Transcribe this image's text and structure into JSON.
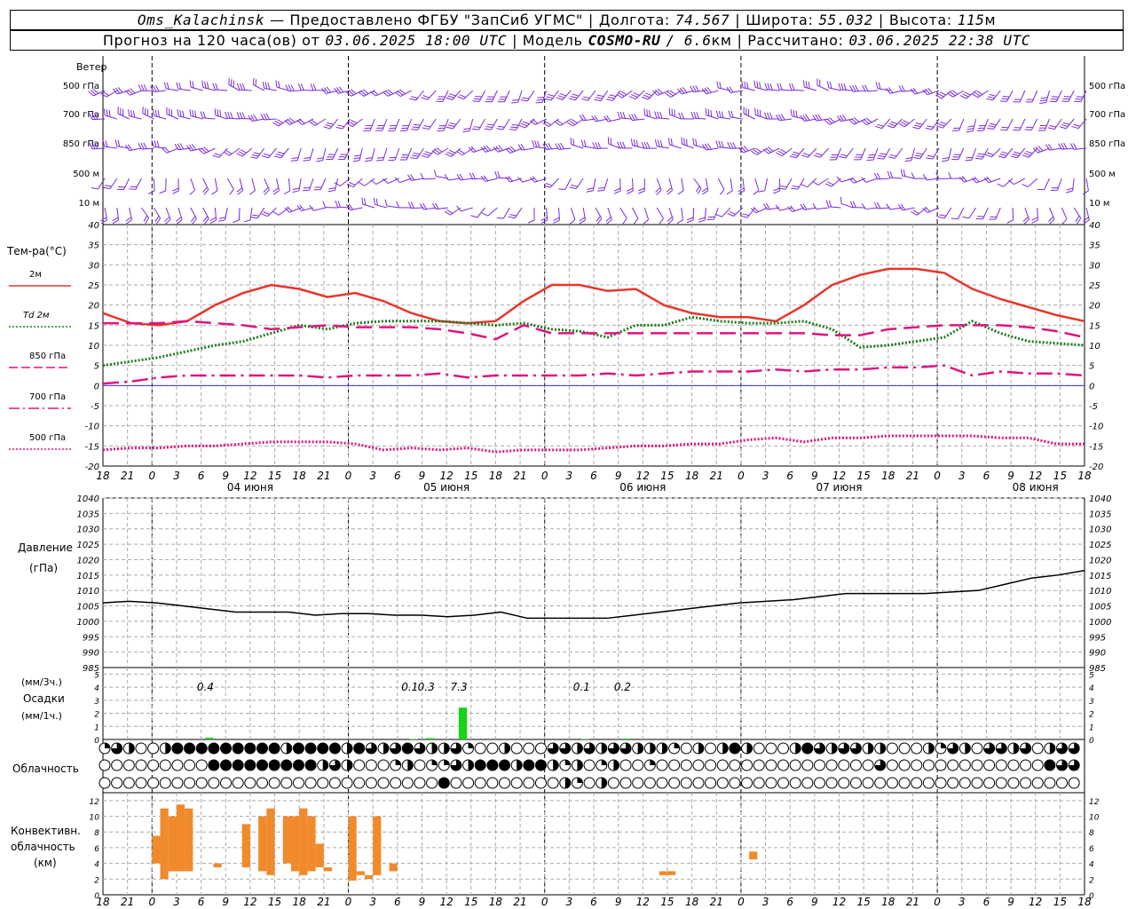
{
  "header": {
    "line1": {
      "station": "Oms_Kalachinsk",
      "provider": "— Предоставлено ФГБУ \"ЗапСиб УГМС\"",
      "lon_label": "Долгота:",
      "lon": "74.567",
      "lat_label": "Широта:",
      "lat": "55.032",
      "alt_label": "Высота:",
      "alt": "115",
      "alt_unit": "м"
    },
    "line2": {
      "forecast_prefix": "Прогноз на 120 часа(ов) от",
      "forecast_time": "03.06.2025 18:00 UTC",
      "model_label": "| Модель",
      "model": "COSMO-RU",
      "model_res": "/ 6.6",
      "model_res_unit": "км",
      "calc_label": "| Рассчитано:",
      "calc_time": "03.06.2025 22:38 UTC"
    }
  },
  "colors": {
    "t2m": "#e8352c",
    "td2m": "#1e7a1e",
    "t850": "#e0147f",
    "t700": "#e0147f",
    "t500": "#e0147f",
    "wind": "#7a2ad6",
    "pressure": "#000000",
    "precip": "#14d414",
    "convective": "#f08a2c",
    "grid": "#aaaaaa",
    "zero_line": "#3030ff"
  },
  "chart_data": [
    {
      "type": "line",
      "name": "wind-panel",
      "title": "Ветер",
      "levels": [
        "500 гПа",
        "700 гПа",
        "850 гПа",
        "500 м",
        "10 м"
      ],
      "icon": "wind-barb",
      "note_icon": "calm-circle"
    },
    {
      "type": "line",
      "name": "temperature-panel",
      "ylabel": "Тем-ра(°C)",
      "ylim": [
        -20,
        40
      ],
      "yticks": [
        -20,
        -15,
        -10,
        -5,
        0,
        5,
        10,
        15,
        20,
        25,
        30,
        35,
        40
      ],
      "x_hours": [
        0,
        3,
        6,
        9,
        12,
        15,
        18,
        21,
        24,
        27,
        30,
        33,
        36,
        39,
        42,
        45,
        48,
        51,
        54,
        57,
        60,
        63,
        66,
        69,
        72,
        75,
        78,
        81,
        84,
        87,
        90,
        93,
        96,
        99,
        102,
        105,
        108,
        111,
        114,
        117,
        120
      ],
      "series": [
        {
          "name": "2м",
          "key": "t2m",
          "style": "solid",
          "values": [
            18,
            15.5,
            15,
            16,
            20,
            23,
            25,
            24,
            22,
            23,
            21,
            18,
            16,
            15.5,
            16,
            21,
            25,
            25,
            23.5,
            24,
            20,
            18,
            17,
            17,
            16,
            20,
            25,
            27.5,
            29,
            29,
            28,
            24,
            21.5,
            19.5,
            17.5,
            16
          ]
        },
        {
          "name": "Td 2м",
          "key": "td2m",
          "style": "dotted",
          "values": [
            5,
            6,
            7,
            8.5,
            10,
            11,
            13,
            15,
            14,
            15.5,
            16,
            16,
            16,
            15.5,
            15,
            15.5,
            14,
            13.5,
            12,
            15,
            15,
            17,
            16,
            15.5,
            15.5,
            16,
            14,
            9.5,
            10,
            11,
            12,
            16,
            13,
            11,
            10.5,
            10
          ]
        },
        {
          "name": "850 гПа",
          "key": "t850",
          "style": "dashed",
          "values": [
            15.5,
            15.5,
            15.5,
            16,
            15.5,
            15,
            14,
            14.5,
            15,
            14.5,
            14.5,
            14.5,
            14,
            13,
            11.5,
            15,
            13,
            13,
            13,
            13,
            13,
            13,
            13,
            13,
            13,
            13,
            12.5,
            12.5,
            14,
            14.5,
            15,
            15,
            15,
            14.5,
            13.5,
            12
          ]
        },
        {
          "name": "700 гПа",
          "key": "t700",
          "style": "dashdot",
          "values": [
            0.5,
            1,
            2,
            2.5,
            2.5,
            2.5,
            2.5,
            2.5,
            2,
            2.5,
            2.5,
            2.5,
            3,
            2,
            2.5,
            2.5,
            2.5,
            2.5,
            3,
            2.5,
            3,
            3.5,
            3.5,
            3.5,
            4,
            3.5,
            4,
            4,
            4.5,
            4.5,
            5,
            2.5,
            3.5,
            3,
            3,
            2.5
          ]
        },
        {
          "name": "500 гПа",
          "key": "t500",
          "style": "dotted",
          "values": [
            -16,
            -15.5,
            -15.5,
            -15,
            -15,
            -14.5,
            -14,
            -14,
            -14,
            -14.5,
            -16,
            -15.5,
            -16,
            -15.5,
            -16.5,
            -16,
            -16,
            -16,
            -15.5,
            -15,
            -15,
            -14.5,
            -14.5,
            -13.5,
            -13,
            -14,
            -13,
            -13,
            -12.5,
            -12.5,
            -12.5,
            -12.5,
            -13,
            -13,
            -14.5,
            -14.5
          ]
        }
      ],
      "x_ticks": [
        "18",
        "21",
        "0",
        "3",
        "6",
        "9",
        "12",
        "15",
        "18",
        "21",
        "0",
        "3",
        "6",
        "9",
        "12",
        "15",
        "18",
        "21",
        "0",
        "3",
        "6",
        "9",
        "12",
        "15",
        "18",
        "21",
        "0",
        "3",
        "6",
        "9",
        "12",
        "15",
        "18",
        "21",
        "0",
        "3",
        "6",
        "9",
        "12",
        "15",
        "18"
      ],
      "day_labels": [
        {
          "hour": 18,
          "text": "04 июня"
        },
        {
          "hour": 42,
          "text": "05 июня"
        },
        {
          "hour": 66,
          "text": "06 июня"
        },
        {
          "hour": 90,
          "text": "07 июня"
        },
        {
          "hour": 114,
          "text": "08 июня"
        }
      ]
    },
    {
      "type": "line",
      "name": "pressure-panel",
      "ylabel": "Давление",
      "yunit": "(гПа)",
      "ylim": [
        985,
        1040
      ],
      "yticks": [
        985,
        990,
        995,
        1000,
        1005,
        1010,
        1015,
        1020,
        1025,
        1030,
        1035,
        1040
      ],
      "series": [
        {
          "name": "pressure",
          "key": "pressure",
          "values": [
            1006,
            1006.5,
            1006,
            1005,
            1004,
            1003,
            1003,
            1003,
            1002,
            1002.5,
            1002.5,
            1002,
            1002,
            1001.5,
            1002,
            1003,
            1001,
            1001,
            1001,
            1001,
            1002,
            1003,
            1004,
            1005,
            1006,
            1006.5,
            1007,
            1008,
            1009,
            1009,
            1009,
            1009,
            1009.5,
            1010,
            1012,
            1014,
            1015,
            1016.5
          ]
        }
      ]
    },
    {
      "type": "bar",
      "name": "precipitation-panel",
      "ylabel": "Осадки",
      "yunit_top": "(мм/3ч.)",
      "yunit_bottom": "(мм/1ч.)",
      "ylim": [
        0,
        5.5
      ],
      "yticks": [
        0,
        1,
        2,
        3,
        4,
        5
      ],
      "bars_hours": [
        13,
        38,
        40,
        44,
        59,
        64
      ],
      "values": [
        0.4,
        0.1,
        0.3,
        7.3,
        0.1,
        0.2
      ],
      "labels": [
        "0.4",
        "0.1",
        "0.3",
        "7.3",
        "0.1",
        "0.2"
      ]
    },
    {
      "type": "table",
      "name": "cloud-cover-panel",
      "ylabel": "Облачность",
      "icon": "cloud-fraction-circle",
      "layers": [
        [
          0.25,
          0.75,
          0.5,
          0,
          0,
          0.5,
          1,
          1,
          1,
          1,
          1,
          1,
          1,
          1,
          1,
          0.5,
          1,
          1,
          1,
          1,
          0.5,
          1,
          0.75,
          0.5,
          0.75,
          1,
          0.75,
          0.5,
          0.5,
          0.75,
          0.25,
          0,
          0,
          0.5,
          0,
          0,
          0,
          0.75,
          0.75,
          0.5,
          0.75,
          0.5,
          0.75,
          0.75,
          0.5,
          0.5,
          0.5,
          0.25,
          0,
          0.5,
          0,
          0.5,
          1,
          0.5,
          0,
          0,
          0,
          0.5,
          1,
          0.75,
          0.5,
          0.75,
          0.75,
          0.5,
          0.5,
          0,
          0,
          0,
          0.5,
          0.25,
          0.75,
          0.5,
          0,
          0.75,
          0.75,
          0.5,
          0.75,
          0,
          0.5,
          0.75,
          0.75
        ],
        [
          0,
          0,
          0,
          0,
          0,
          0,
          0,
          0,
          0,
          1,
          1,
          1,
          1,
          1,
          1,
          1,
          1,
          1,
          0.5,
          0.75,
          0.5,
          0,
          0,
          0,
          0.25,
          0.5,
          0,
          0.25,
          0.25,
          0.75,
          0.5,
          1,
          1,
          1,
          0.5,
          1,
          1,
          0.5,
          0.25,
          0.5,
          0,
          0.25,
          0.5,
          0,
          0,
          0.25,
          0,
          0,
          0,
          0,
          0,
          0,
          0,
          0,
          0,
          0,
          0,
          0,
          0,
          0,
          0,
          0,
          0,
          0,
          0.75,
          0,
          0,
          0,
          0,
          0,
          0,
          0,
          0,
          0,
          0,
          0,
          0,
          0,
          1,
          0.75,
          0.75
        ],
        [
          0,
          0,
          0,
          0,
          0,
          0,
          0,
          0,
          0,
          0,
          0,
          0,
          0,
          0,
          0,
          0,
          0,
          0,
          0,
          0,
          0,
          0,
          0,
          0,
          0,
          0,
          0,
          0,
          1,
          0,
          0,
          0,
          0,
          0,
          0,
          0,
          0,
          0,
          0.5,
          0.25,
          0,
          0.5,
          0,
          0,
          0,
          0,
          0,
          0,
          0,
          0,
          0,
          0,
          0,
          0,
          0,
          0,
          0,
          0,
          0,
          0,
          0,
          0,
          0,
          0,
          0,
          0,
          0,
          0,
          0,
          0,
          0,
          0,
          0,
          0,
          0,
          0,
          0,
          0,
          0,
          0,
          0
        ]
      ]
    },
    {
      "type": "bar",
      "name": "convective-cloud-panel",
      "ylabel_lines": [
        "Конвективн.",
        "облачность",
        "(км)"
      ],
      "ylim": [
        0,
        13
      ],
      "yticks": [
        0,
        2,
        4,
        6,
        8,
        10,
        12
      ],
      "bars": [
        {
          "hour": 6.5,
          "base": 4,
          "top": 7.5
        },
        {
          "hour": 7.5,
          "base": 2,
          "top": 11
        },
        {
          "hour": 8.5,
          "base": 3,
          "top": 10
        },
        {
          "hour": 9.5,
          "base": 3,
          "top": 11.5
        },
        {
          "hour": 10.5,
          "base": 3,
          "top": 11
        },
        {
          "hour": 14,
          "base": 3.5,
          "top": 4
        },
        {
          "hour": 17.5,
          "base": 3.5,
          "top": 9
        },
        {
          "hour": 19.5,
          "base": 3,
          "top": 10
        },
        {
          "hour": 20.5,
          "base": 2.5,
          "top": 11
        },
        {
          "hour": 22.5,
          "base": 4,
          "top": 10
        },
        {
          "hour": 23.5,
          "base": 3,
          "top": 10
        },
        {
          "hour": 24.5,
          "base": 2.5,
          "top": 11
        },
        {
          "hour": 25.5,
          "base": 3,
          "top": 10
        },
        {
          "hour": 26.5,
          "base": 3.5,
          "top": 6.5
        },
        {
          "hour": 27.5,
          "base": 3,
          "top": 3.5
        },
        {
          "hour": 30.5,
          "base": 1.8,
          "top": 10
        },
        {
          "hour": 31.5,
          "base": 2.5,
          "top": 3
        },
        {
          "hour": 32.5,
          "base": 2,
          "top": 2.5
        },
        {
          "hour": 33.5,
          "base": 2.5,
          "top": 10
        },
        {
          "hour": 35.5,
          "base": 3,
          "top": 4
        },
        {
          "hour": 68.5,
          "base": 2.5,
          "top": 3
        },
        {
          "hour": 69.5,
          "base": 2.5,
          "top": 3
        },
        {
          "hour": 79.5,
          "base": 4.5,
          "top": 5.5
        }
      ]
    }
  ]
}
